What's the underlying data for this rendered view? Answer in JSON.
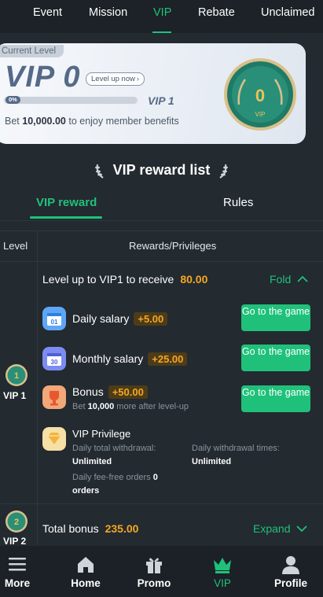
{
  "top_tabs": [
    {
      "label": "Event"
    },
    {
      "label": "Mission"
    },
    {
      "label": "VIP",
      "active": true
    },
    {
      "label": "Rebate"
    },
    {
      "label": "Unclaimed"
    }
  ],
  "level_card": {
    "tag": "Current Level",
    "current_level": "VIP 0",
    "level_up_label": "Level up now",
    "progress_percent_text": "0%",
    "progress_fraction": 0.0,
    "next_level": "VIP 1",
    "bet_prefix": "Bet",
    "bet_amount": "10,000.00",
    "bet_suffix": "to enjoy member benefits",
    "medal_number": "0",
    "medal_text": "VIP"
  },
  "section": {
    "title": "VIP reward list",
    "tabs": [
      {
        "label": "VIP reward",
        "active": true
      },
      {
        "label": "Rules"
      }
    ]
  },
  "table": {
    "header_level": "Level",
    "header_rewards": "Rewards/Privileges",
    "rows": [
      {
        "level_label": "VIP 1"
      },
      {
        "level_label": "VIP 2"
      }
    ]
  },
  "vip1": {
    "level_up_text": "Level up to VIP1 to receive",
    "level_up_amount": "80.00",
    "fold_label": "Fold",
    "rewards": [
      {
        "label": "Daily salary",
        "amount": "+5.00",
        "button": "Go to the game",
        "icon_text": "01"
      },
      {
        "label": "Monthly salary",
        "amount": "+25.00",
        "button": "Go to the game",
        "icon_text": "30"
      },
      {
        "label": "Bonus",
        "amount": "+50.00",
        "button": "Go to the game"
      }
    ],
    "bonus_sub_prefix": "Bet",
    "bonus_sub_amount": "10,000",
    "bonus_sub_suffix": "more after level-up",
    "privilege_title": "VIP Privilege",
    "daily_withdrawal_label": "Daily total withdrawal:",
    "daily_withdrawal_value": "Unlimited",
    "daily_times_label": "Daily withdrawal times:",
    "daily_times_value": "Unlimited",
    "fee_free_label": "Daily fee-free orders",
    "fee_free_value": "0",
    "fee_free_unit": "orders"
  },
  "vip2": {
    "total_bonus_label": "Total bonus",
    "total_bonus_amount": "235.00",
    "expand_label": "Expand"
  },
  "bottom_nav": [
    {
      "label": "More",
      "icon": "menu-icon"
    },
    {
      "label": "Home",
      "icon": "home-icon"
    },
    {
      "label": "Promo",
      "icon": "gift-icon"
    },
    {
      "label": "VIP",
      "icon": "crown-icon",
      "active": true
    },
    {
      "label": "Profile",
      "icon": "user-icon"
    }
  ],
  "colors": {
    "accent": "#1fc17a",
    "amount": "#f5a623",
    "background": "#232a30"
  }
}
